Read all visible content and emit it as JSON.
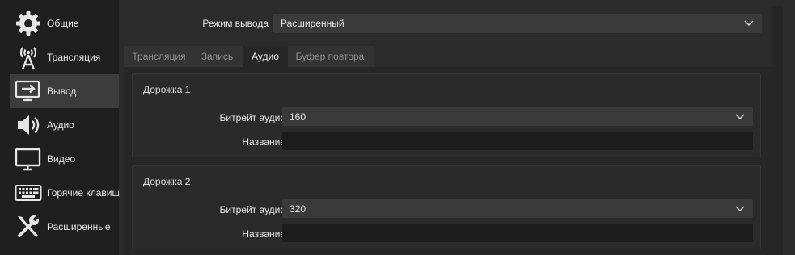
{
  "sidebar": {
    "items": [
      {
        "label": "Общие",
        "icon": "gear-icon"
      },
      {
        "label": "Трансляция",
        "icon": "antenna-icon"
      },
      {
        "label": "Вывод",
        "icon": "output-monitor-icon",
        "active": true
      },
      {
        "label": "Аудио",
        "icon": "speaker-icon"
      },
      {
        "label": "Видео",
        "icon": "monitor-icon"
      },
      {
        "label": "Горячие клавиши",
        "icon": "keyboard-icon"
      },
      {
        "label": "Расширенные",
        "icon": "wrench-screwdriver-icon"
      }
    ]
  },
  "output_mode": {
    "label": "Режим вывода",
    "value": "Расширенный"
  },
  "tabs": [
    {
      "label": "Трансляция"
    },
    {
      "label": "Запись"
    },
    {
      "label": "Аудио",
      "active": true
    },
    {
      "label": "Буфер повтора"
    }
  ],
  "tracks": [
    {
      "title": "Дорожка 1",
      "bitrate_label": "Битрейт аудио",
      "bitrate_value": "160",
      "name_label": "Название",
      "name_value": ""
    },
    {
      "title": "Дорожка 2",
      "bitrate_label": "Битрейт аудио",
      "bitrate_value": "320",
      "name_label": "Название",
      "name_value": ""
    }
  ],
  "colors": {
    "sidebar_bg": "#1f1f1f",
    "active_item": "#3c3c3c",
    "panel_bg": "#262626",
    "window_bg": "#2b2b2b"
  }
}
